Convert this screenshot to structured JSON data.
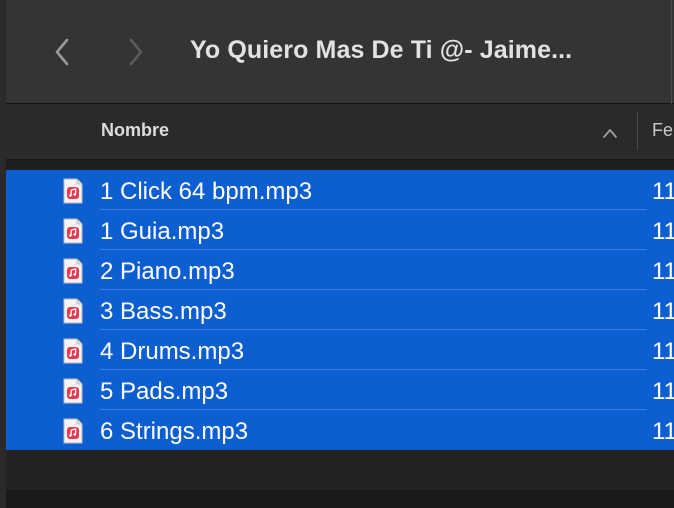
{
  "window": {
    "title": "Yo Quiero Mas De Ti @- Jaime..."
  },
  "nav": {
    "back_icon": "chevron-left",
    "forward_icon": "chevron-right"
  },
  "columns": {
    "name": "Nombre",
    "date_partial": "Fe",
    "sort": "ascending"
  },
  "colors": {
    "selection": "#0d5ed0",
    "icon_badge": "#e8384f"
  },
  "files": [
    {
      "name": "1 Click 64 bpm.mp3",
      "date_partial": "11",
      "icon": "audio-file-icon",
      "selected": true
    },
    {
      "name": "1 Guia.mp3",
      "date_partial": "11",
      "icon": "audio-file-icon",
      "selected": true
    },
    {
      "name": "2 Piano.mp3",
      "date_partial": "11",
      "icon": "audio-file-icon",
      "selected": true
    },
    {
      "name": "3 Bass.mp3",
      "date_partial": "11",
      "icon": "audio-file-icon",
      "selected": true
    },
    {
      "name": "4 Drums.mp3",
      "date_partial": "11",
      "icon": "audio-file-icon",
      "selected": true
    },
    {
      "name": "5 Pads.mp3",
      "date_partial": "11",
      "icon": "audio-file-icon",
      "selected": true
    },
    {
      "name": "6 Strings.mp3",
      "date_partial": "11",
      "icon": "audio-file-icon",
      "selected": true
    }
  ]
}
